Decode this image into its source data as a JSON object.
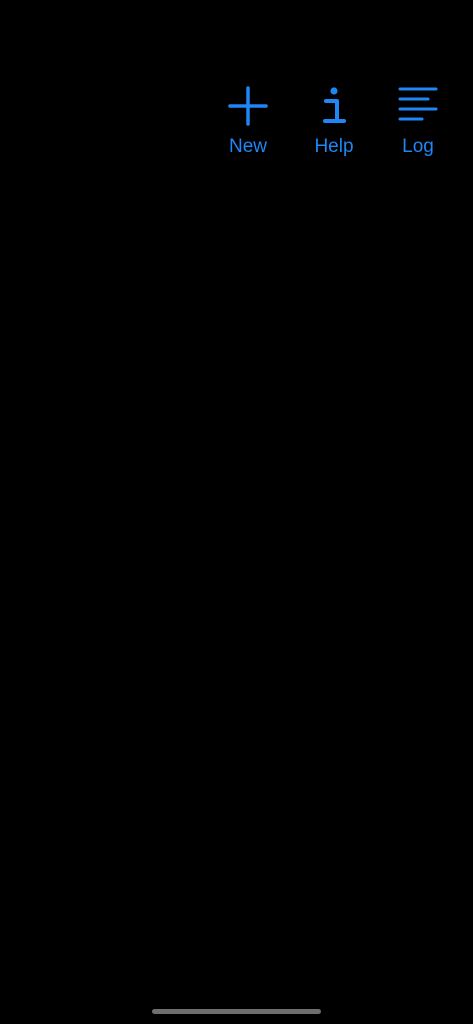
{
  "toolbar": {
    "accent_color": "#1e86f5",
    "buttons": [
      {
        "label": "New",
        "icon": "plus-icon"
      },
      {
        "label": "Help",
        "icon": "info-icon"
      },
      {
        "label": "Log",
        "icon": "lines-icon"
      }
    ]
  }
}
